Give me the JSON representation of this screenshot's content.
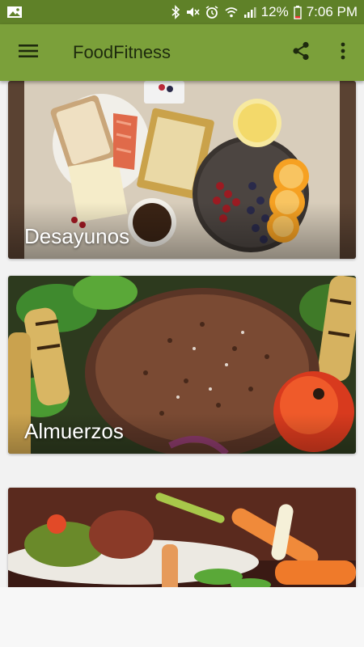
{
  "status_bar": {
    "battery": "12%",
    "time": "7:06 PM",
    "icons": [
      "image-icon",
      "bluetooth-icon",
      "mute-icon",
      "alarm-icon",
      "wifi-icon",
      "signal-icon",
      "battery-icon"
    ]
  },
  "app_bar": {
    "title": "FoodFitness",
    "icons": [
      "menu-icon",
      "share-icon",
      "more-vert-icon"
    ]
  },
  "cards": [
    {
      "label": "Desayunos"
    },
    {
      "label": "Almuerzos"
    },
    {
      "label": ""
    }
  ],
  "colors": {
    "status_bar": "#5f8128",
    "app_bar": "#7ba03a",
    "background": "#f2f2f2"
  }
}
